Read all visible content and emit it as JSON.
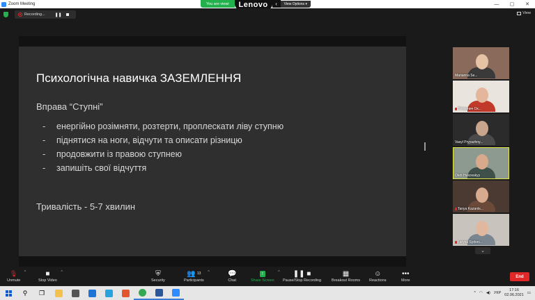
{
  "window": {
    "title": "Zoom Meeting",
    "controls": [
      "—",
      "▢",
      "✕"
    ]
  },
  "share_banner": {
    "status_text": "You are viewi",
    "brand": "Lenovo",
    "view_options_label": "View Options"
  },
  "recording": {
    "label": "Recording...",
    "pause_icon": "pause-icon",
    "stop_icon": "stop-icon"
  },
  "view_button": {
    "label": "View"
  },
  "slide": {
    "title": "Психологічна навичка ЗАЗЕМЛЕННЯ",
    "subtitle": "Вправа “Ступні”",
    "bullets": [
      "енергійно розімняти, розтерти, проплескати ліву ступню",
      "піднятися на ноги, відчути та описати різницю",
      "продовжити із правою ступнею",
      "запишіть свої відчуття"
    ],
    "duration": "Тривалість - 5-7 хвилин"
  },
  "participants_gallery": [
    {
      "name": "Marianna Se...",
      "muted": false,
      "active": false,
      "bg": "#8a6a5a",
      "skin": "#e7c3a6",
      "shirt": "#3a3a3a"
    },
    {
      "name": "Петринич Ок...",
      "muted": true,
      "active": false,
      "bg": "#e9e4de",
      "skin": "#e4b69b",
      "shirt": "#c0392b"
    },
    {
      "name": "Vasyl Pryyazhny...",
      "muted": false,
      "active": false,
      "bg": "#2b2b2b",
      "skin": "#c9a58c",
      "shirt": "#4a4a4a"
    },
    {
      "name": "Oleh Hukovskyy",
      "muted": false,
      "active": true,
      "bg": "#8d9a90",
      "skin": "#d9a98c",
      "shirt": "#3f4f4a"
    },
    {
      "name": "Tanya Kazants...",
      "muted": true,
      "active": false,
      "bg": "#4a3a32",
      "skin": "#d8aa8e",
      "shirt": "#6b4a3a"
    },
    {
      "name": "Larysa Sydorc...",
      "muted": true,
      "active": false,
      "bg": "#c9c3bd",
      "skin": "#e1b89e",
      "shirt": "#7a8590"
    }
  ],
  "gallery_more": {
    "icon": "chevron-down-icon"
  },
  "toolbar": {
    "unmute": "Unmute",
    "stop_video": "Stop Video",
    "security": "Security",
    "participants": "Participants",
    "participants_count": "13",
    "chat": "Chat",
    "share_screen": "Share Screen",
    "pause_stop_recording": "Pause/Stop Recording",
    "breakout_rooms": "Breakout Rooms",
    "reactions": "Reactions",
    "more": "More",
    "end": "End"
  },
  "taskbar": {
    "apps": [
      "search",
      "task-view",
      "file-explorer",
      "store",
      "mail",
      "lenovo-vantage",
      "office",
      "chrome",
      "word",
      "zoom"
    ],
    "language": "УКР",
    "time": "17:16",
    "date": "02.06.2021"
  }
}
